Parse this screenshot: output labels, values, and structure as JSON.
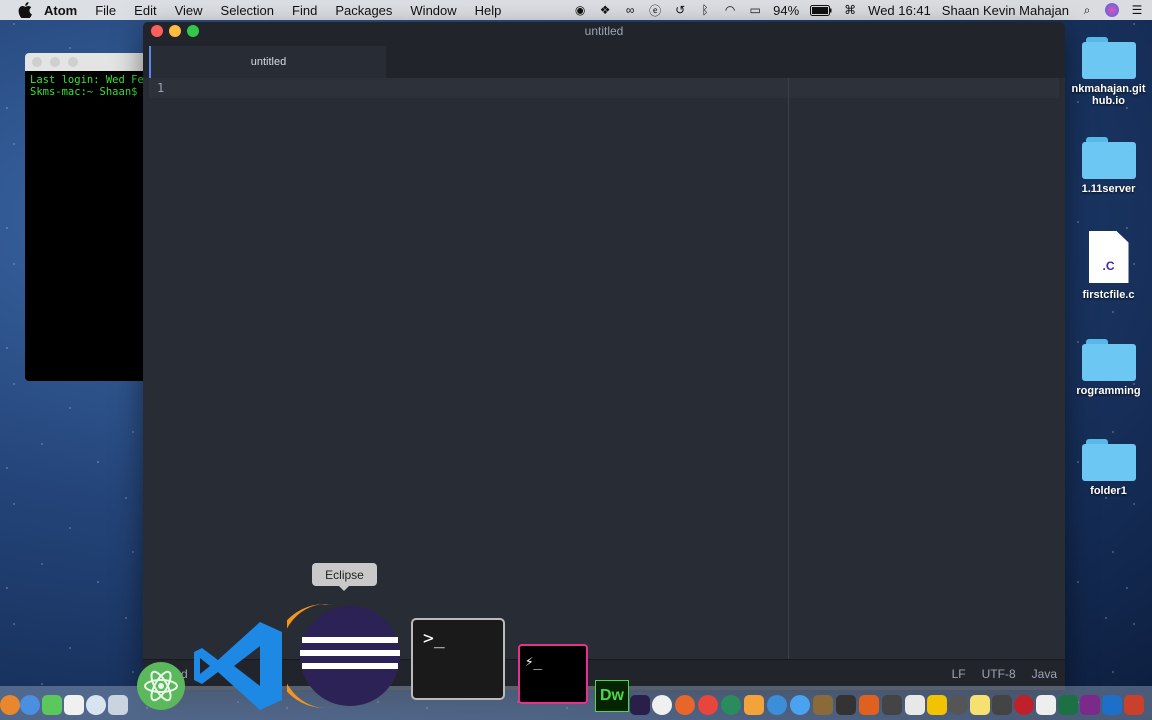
{
  "menubar": {
    "app_name": "Atom",
    "items": [
      "File",
      "Edit",
      "View",
      "Selection",
      "Find",
      "Packages",
      "Window",
      "Help"
    ],
    "battery": "94%",
    "clock": "Wed 16:41",
    "user": "Shaan Kevin Mahajan"
  },
  "terminal": {
    "line1": "Last login: Wed Fe",
    "line2": "Skms-mac:~ Shaan$"
  },
  "atom": {
    "window_title": "untitled",
    "tab_label": "untitled",
    "line_number": "1",
    "status_left": "d",
    "status_line_ending": "LF",
    "status_encoding": "UTF-8",
    "status_grammar": "Java"
  },
  "desktop": {
    "items": [
      {
        "label1": "nkmahajan.git",
        "label2": "hub.io",
        "kind": "folder"
      },
      {
        "label1": "1.11server",
        "label2": "",
        "kind": "folder"
      },
      {
        "label1": "firstcfile.c",
        "label2": "",
        "kind": "file",
        "ext": ".C"
      },
      {
        "label1": "rogramming",
        "label2": "",
        "kind": "folder"
      },
      {
        "label1": "folder1",
        "label2": "",
        "kind": "folder"
      }
    ]
  },
  "dock": {
    "tooltip": "Eclipse",
    "dw_label": "Dw",
    "terminal_prompt": ">_",
    "hyper_prompt": "⚡_"
  }
}
